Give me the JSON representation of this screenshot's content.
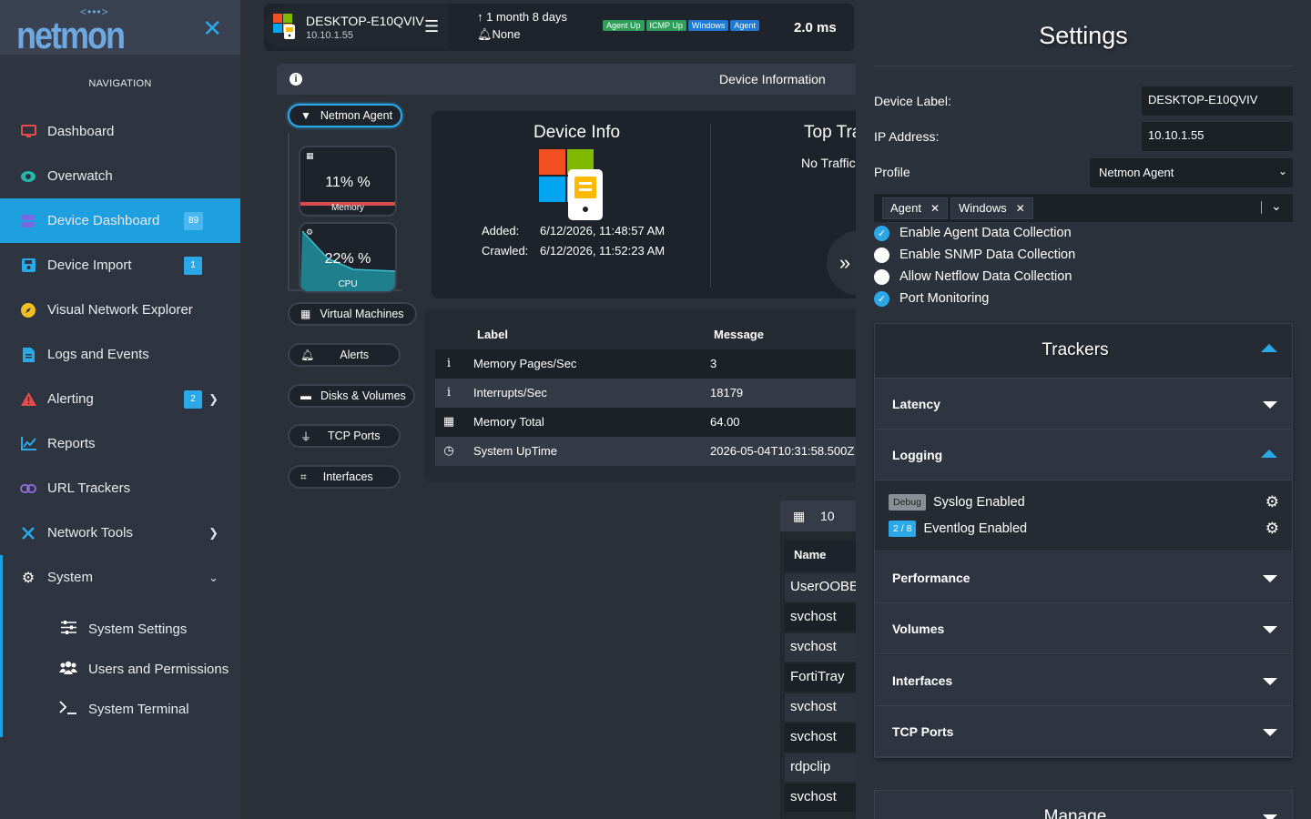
{
  "app": {
    "logo_text": "netmon",
    "logo_dots": "<•••>"
  },
  "nav": {
    "title": "NAVIGATION",
    "items": [
      {
        "label": "Dashboard",
        "icon": "monitor-icon",
        "color": "#e84b4b"
      },
      {
        "label": "Overwatch",
        "icon": "eye-icon",
        "color": "#22b8a8"
      },
      {
        "label": "Device Dashboard",
        "icon": "server-icon",
        "color": "#6a5ad8",
        "badge": "89",
        "active": true
      },
      {
        "label": "Device Import",
        "icon": "floppy-icon",
        "color": "#2aa8e8",
        "badge": "1"
      },
      {
        "label": "Visual Network Explorer",
        "icon": "compass-icon",
        "color": "#f0c020"
      },
      {
        "label": "Logs and Events",
        "icon": "document-icon",
        "color": "#2aa8e8"
      },
      {
        "label": "Alerting",
        "icon": "warning-icon",
        "color": "#e84b4b",
        "badge": "2"
      },
      {
        "label": "Reports",
        "icon": "chart-line-icon",
        "color": "#2aa8e8"
      },
      {
        "label": "URL Trackers",
        "icon": "link-icon",
        "color": "#8a6ad8"
      },
      {
        "label": "Network Tools",
        "icon": "tools-icon",
        "color": "#2aa8e8"
      },
      {
        "label": "System",
        "icon": "gear-icon",
        "color": "#ffffff"
      }
    ],
    "sub_items": [
      {
        "label": "System Settings",
        "icon": "sliders-icon"
      },
      {
        "label": "Users and Permissions",
        "icon": "users-icon"
      },
      {
        "label": "System Terminal",
        "icon": "terminal-icon"
      }
    ]
  },
  "topbar": {
    "device_name": "DESKTOP-E10QVIV",
    "device_ip": "10.10.1.55",
    "uptime": "1 month 8 days",
    "alerts": "None",
    "tags": [
      "Agent Up",
      "ICMP Up",
      "Windows",
      "Agent"
    ],
    "latency": "2.0 ms"
  },
  "device_information": {
    "header": "Device Information",
    "buttons": {
      "agent": "Netmon Agent",
      "vms": "Virtual Machines",
      "alerts": "Alerts",
      "disks": "Disks & Volumes",
      "tcp": "TCP Ports",
      "interfaces": "Interfaces"
    },
    "memory": {
      "value": "11% %",
      "label": "Memory",
      "level": 0.11
    },
    "cpu": {
      "value": "22% %",
      "label": "CPU",
      "level": 0.22
    },
    "info_title": "Device Info",
    "added_label": "Added:",
    "added_value": "6/12/2026, 11:48:57 AM",
    "crawled_label": "Crawled:",
    "crawled_value": "6/12/2026, 11:52:23 AM",
    "top_traffic_title": "Top Tra",
    "top_traffic_none": "No Traffic",
    "table": {
      "col_label": "Label",
      "col_message": "Message",
      "rows": [
        {
          "icon": "info-icon",
          "label": "Memory Pages/Sec",
          "message": "3"
        },
        {
          "icon": "info-icon",
          "label": "Interrupts/Sec",
          "message": "18179"
        },
        {
          "icon": "memory-icon",
          "label": "Memory Total",
          "message": "64.00"
        },
        {
          "icon": "clock-icon",
          "label": "System UpTime",
          "message": "2026-05-04T10:31:58.500Z"
        }
      ]
    }
  },
  "processes": {
    "page_size": "10",
    "col_name": "Name",
    "rows": [
      "UserOOBEBroker",
      "svchost",
      "svchost",
      "FortiTray",
      "svchost",
      "svchost",
      "rdpclip",
      "svchost"
    ]
  },
  "settings": {
    "title": "Settings",
    "device_label_label": "Device Label:",
    "device_label_value": "DESKTOP-E10QVIV",
    "ip_label": "IP Address:",
    "ip_value": "10.10.1.55",
    "profile_label": "Profile",
    "profile_value": "Netmon Agent",
    "chips": [
      "Agent",
      "Windows"
    ],
    "checks": [
      {
        "label": "Enable Agent Data Collection",
        "checked": true
      },
      {
        "label": "Enable SNMP Data Collection",
        "checked": false
      },
      {
        "label": "Allow Netflow Data Collection",
        "checked": false
      },
      {
        "label": "Port Monitoring",
        "checked": true
      }
    ],
    "trackers": {
      "title": "Trackers",
      "sections": [
        "Latency",
        "Logging",
        "Performance",
        "Volumes",
        "Interfaces",
        "TCP Ports"
      ],
      "logging": [
        {
          "badge": "Debug",
          "label": "Syslog Enabled"
        },
        {
          "badge": "2 / 8",
          "label": "Eventlog Enabled"
        }
      ]
    },
    "manage_title": "Manage"
  }
}
